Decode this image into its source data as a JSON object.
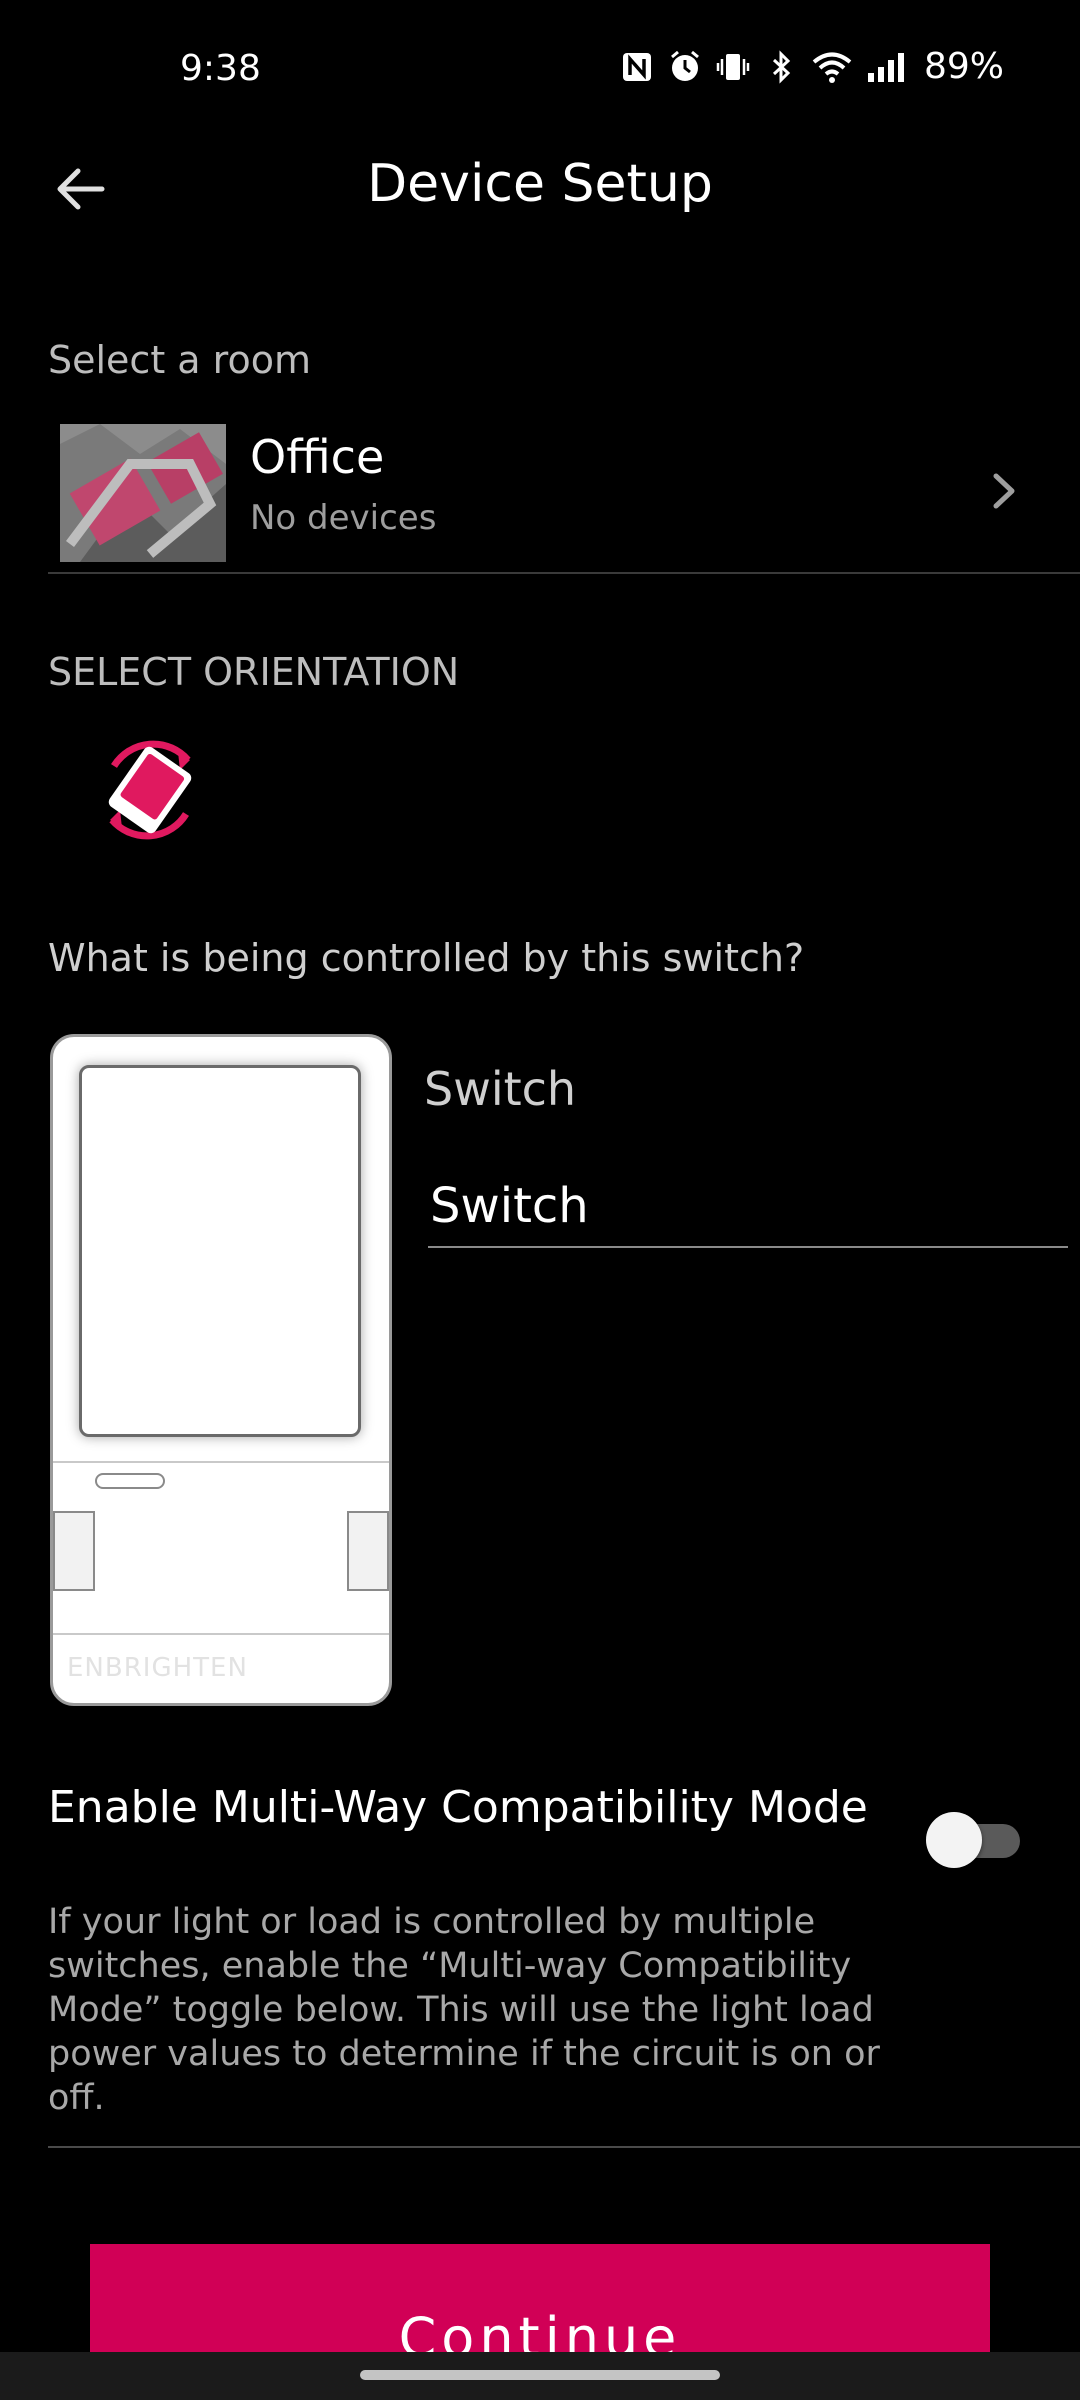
{
  "status_bar": {
    "time": "9:38",
    "battery": "89%",
    "icons": [
      "nfc-icon",
      "alarm-icon",
      "vibrate-icon",
      "bluetooth-icon",
      "wifi-icon",
      "signal-icon"
    ]
  },
  "app_bar": {
    "title": "Device Setup",
    "back_icon": "arrow-left-icon"
  },
  "room": {
    "section_label": "Select a room",
    "name": "Office",
    "subtitle": "No devices"
  },
  "orientation": {
    "section_label": "SELECT ORIENTATION",
    "icon": "rotate-device-icon"
  },
  "control": {
    "question": "What is being controlled by this switch?",
    "type_label": "Switch",
    "name_value": "Switch",
    "device_brand": "ENBRIGHTEN"
  },
  "multiway": {
    "title": "Enable Multi-Way Compatibility Mode",
    "enabled": false,
    "description": "If your light or load is controlled by multiple switches, enable the “Multi-way Compatibility Mode” toggle below. This will use the light load power values to determine if the circuit is on or off."
  },
  "actions": {
    "continue_label": "Continue"
  },
  "colors": {
    "accent": "#d10056",
    "background": "#000000",
    "text_primary": "#ffffff",
    "text_secondary": "#a8a8a8"
  }
}
